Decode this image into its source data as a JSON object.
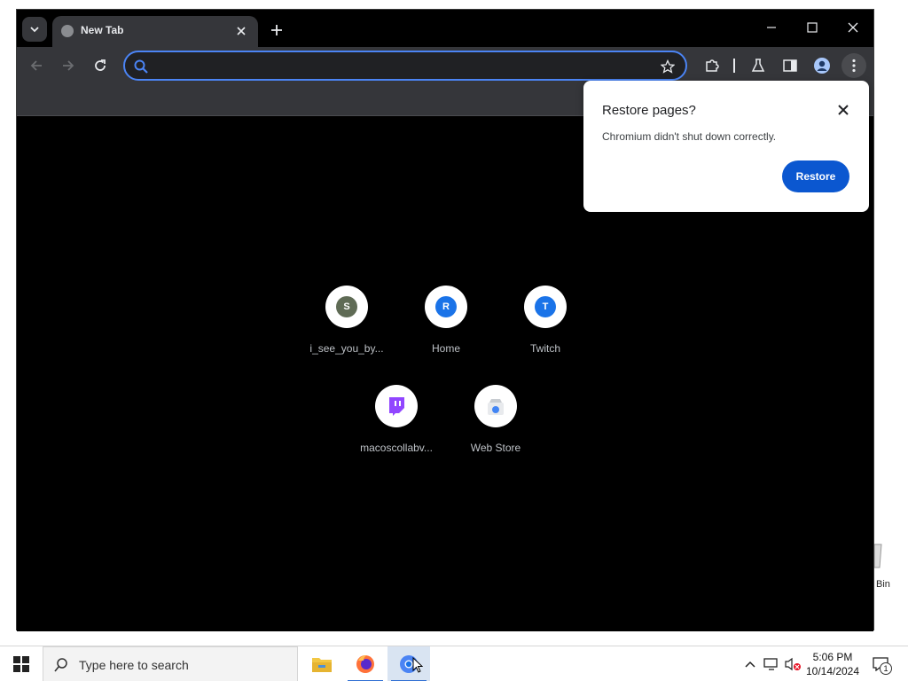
{
  "desktop": {
    "recycle_bin_label": "Bin"
  },
  "browser": {
    "tab": {
      "title": "New Tab"
    },
    "omnibox": {
      "value": "",
      "placeholder": ""
    },
    "shortcuts": [
      {
        "label": "i_see_you_by...",
        "letter": "S",
        "icon_color": "#5f6b55"
      },
      {
        "label": "Home",
        "letter": "R",
        "icon_color": "#1a73e8"
      },
      {
        "label": "Twitch",
        "letter": "T",
        "icon_color": "#1a73e8"
      },
      {
        "label": "macoscollabv...",
        "letter": "",
        "icon_color": "#9146ff"
      },
      {
        "label": "Web Store",
        "letter": "",
        "icon_color": "#4285f4"
      }
    ],
    "restore_popup": {
      "title": "Restore pages?",
      "message": "Chromium didn't shut down correctly.",
      "restore_label": "Restore"
    }
  },
  "taskbar": {
    "search_placeholder": "Type here to search",
    "time": "5:06 PM",
    "date": "10/14/2024",
    "notification_count": "1"
  },
  "colors": {
    "accent": "#0b57d0",
    "omnibox_border": "#4b84f4",
    "toolbar": "#35363a",
    "page_bg": "#000000"
  }
}
